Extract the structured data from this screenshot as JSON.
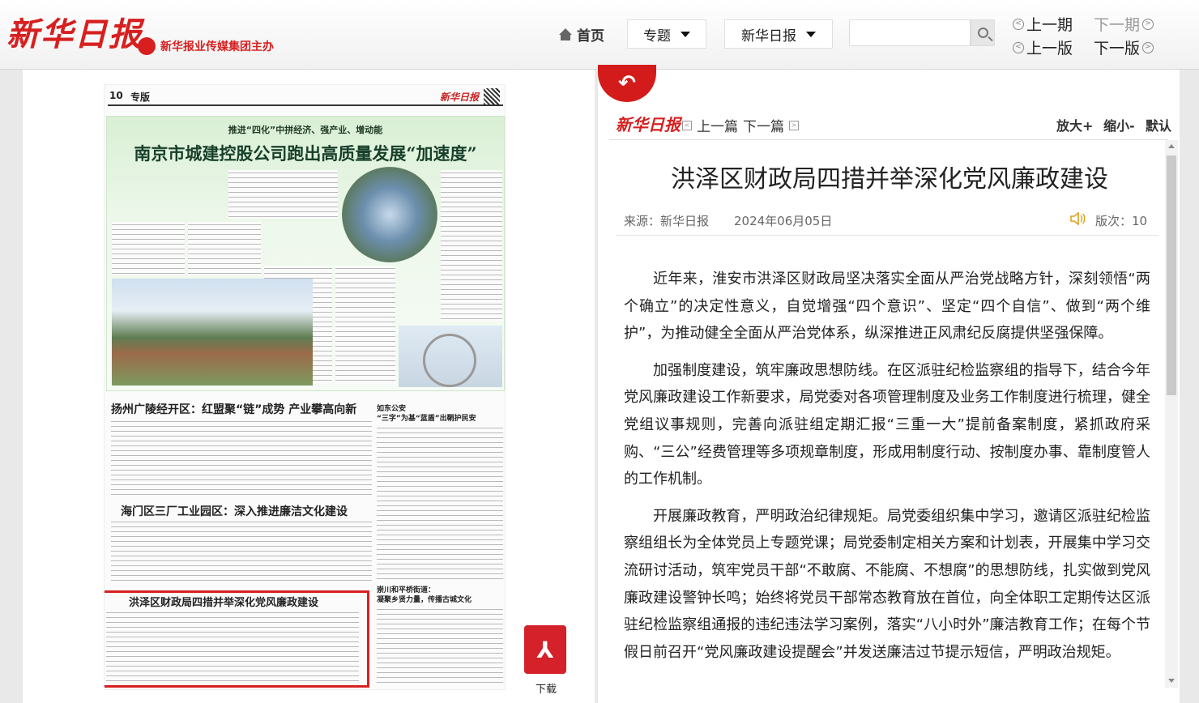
{
  "header": {
    "logo": "新华日报",
    "sublogo": "新华报业传媒集团主办",
    "nav": {
      "home": "首页",
      "topics": "专题",
      "paper": "新华日报"
    },
    "search": {
      "placeholder": ""
    },
    "issue_nav": {
      "prev_issue": "上一期",
      "next_issue": "下一期",
      "prev_page": "上一版",
      "next_page": "下一版"
    }
  },
  "newspaper": {
    "page_label": "10",
    "section": "专版",
    "masthead": "新华日报",
    "feature_sub": "推进“四化”中拼经济、强产业、增动能",
    "feature_title": "南京市城建控股公司跑出高质量发展“加速度”",
    "headlines": [
      "扬州广陵经开区：红盟聚“链”成势 产业攀高向新",
      "海门区三厂工业园区：深入推进廉洁文化建设",
      "洪泽区财政局四措并举深化党风廉政建设"
    ],
    "side_heads": [
      "如东公安",
      "“三字”为基“蓝盾”出鞘护民安",
      "崇川和平桥街道：",
      "凝聚乡贤力量，传播古城文化"
    ],
    "download_label": "下载"
  },
  "article": {
    "logo": "新华日报",
    "prev": "上一篇",
    "next": "下一篇",
    "zoom_in": "放大+",
    "zoom_out": "缩小-",
    "zoom_default": "默认",
    "title": "洪泽区财政局四措并举深化党风廉政建设",
    "source": "来源：新华日报",
    "date": "2024年06月05日",
    "page_no": "版次：10",
    "paragraphs": [
      "近年来，淮安市洪泽区财政局坚决落实全面从严治党战略方针，深刻领悟“两个确立”的决定性意义，自觉增强“四个意识”、坚定“四个自信”、做到“两个维护”，为推动健全全面从严治党体系，纵深推进正风肃纪反腐提供坚强保障。",
      "加强制度建设，筑牢廉政思想防线。在区派驻纪检监察组的指导下，结合今年党风廉政建设工作新要求，局党委对各项管理制度及业务工作制度进行梳理，健全党组议事规则，完善向派驻组定期汇报“三重一大”提前备案制度，紧抓政府采购、“三公”经费管理等多项规章制度，形成用制度行动、按制度办事、靠制度管人的工作机制。",
      "开展廉政教育，严明政治纪律规矩。局党委组织集中学习，邀请区派驻纪检监察组组长为全体党员上专题党课；局党委制定相关方案和计划表，开展集中学习交流研讨活动，筑牢党员干部“不敢腐、不能腐、不想腐”的思想防线，扎实做到党风廉政建设警钟长鸣；始终将党员干部常态教育放在首位，向全体职工定期传达区派驻纪检监察组通报的违纪违法学习案例，落实“八小时外”廉洁教育工作；在每个节假日前召开“党风廉政建设提醒会”并发送廉洁过节提示短信，严明政治规矩。"
    ]
  }
}
